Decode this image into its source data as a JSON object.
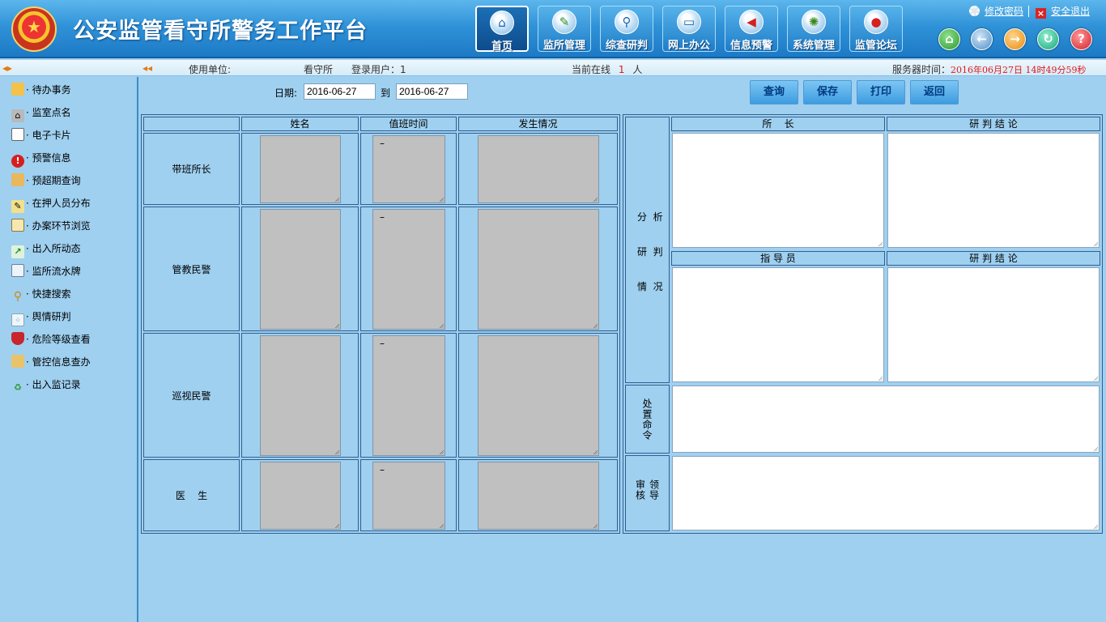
{
  "header": {
    "title": "公安监管看守所警务工作平台",
    "nav": [
      {
        "label": "首页",
        "icon": "home-icon"
      },
      {
        "label": "监所管理",
        "icon": "feather-icon"
      },
      {
        "label": "综查研判",
        "icon": "magnifier-icon"
      },
      {
        "label": "网上办公",
        "icon": "monitor-icon"
      },
      {
        "label": "信息预警",
        "icon": "alert-flag-icon"
      },
      {
        "label": "系统管理",
        "icon": "gear-icon"
      },
      {
        "label": "监管论坛",
        "icon": "forum-icon"
      }
    ],
    "change_password": "修改密码",
    "logout": "安全退出",
    "quick_icons": [
      "home-icon",
      "back-icon",
      "forward-icon",
      "refresh-icon",
      "help-icon"
    ]
  },
  "status": {
    "unit_label": "使用单位:",
    "unit_value": "看守所",
    "user_label": "登录用户：1",
    "online_prefix": "当前在线",
    "online_count": "1",
    "online_suffix": "人",
    "server_time_label": "服务器时间：",
    "server_time_value": "2016年06月27日  14时49分59秒"
  },
  "sidebar": {
    "items": [
      {
        "label": "· 待办事务",
        "icon": "clipboard-icon"
      },
      {
        "label": "· 监室点名",
        "icon": "building-icon"
      },
      {
        "label": "· 电子卡片",
        "icon": "id-card-icon"
      },
      {
        "label": "· 预警信息",
        "icon": "warning-icon"
      },
      {
        "label": "· 预超期查询",
        "icon": "users-icon"
      },
      {
        "label": "· 在押人员分布",
        "icon": "edit-icon"
      },
      {
        "label": "· 办案环节浏览",
        "icon": "document-icon"
      },
      {
        "label": "· 出入所动态",
        "icon": "trend-chart-icon"
      },
      {
        "label": "· 监所流水牌",
        "icon": "form-icon"
      },
      {
        "label": "· 快捷搜索",
        "icon": "search-icon"
      },
      {
        "label": "· 舆情研判",
        "icon": "scatter-chart-icon"
      },
      {
        "label": "· 危险等级查看",
        "icon": "shield-icon"
      },
      {
        "label": "· 管控信息查办",
        "icon": "user-search-icon"
      },
      {
        "label": "· 出入监记录",
        "icon": "recycle-icon"
      }
    ]
  },
  "filter": {
    "date_label": "日期:",
    "date_from": "2016-06-27",
    "to_label": "到",
    "date_to": "2016-06-27"
  },
  "buttons": {
    "query": "查询",
    "save": "保存",
    "print": "打印",
    "back": "返回"
  },
  "duty_table": {
    "headers": [
      "姓名",
      "值班时间",
      "发生情况"
    ],
    "rows": [
      {
        "label": "带班所长",
        "time": "–"
      },
      {
        "label": "管教民警",
        "time": "–"
      },
      {
        "label": "巡视民警",
        "time": "–"
      },
      {
        "label": "医    生",
        "time": "–"
      }
    ]
  },
  "analysis": {
    "side_label": [
      "分  析",
      "研  判",
      "情  况"
    ],
    "director_header": "所    长",
    "conclusion_header": "研 判 结 论",
    "instructor_header": "指 导 员",
    "conclusion_header_2": "研 判 结 论",
    "disposal_label": "处置命令",
    "review_label": "领导审核"
  },
  "colors": {
    "accent": "#2f92d8",
    "panel": "#9fd0f0",
    "server_time": "#e21818"
  }
}
